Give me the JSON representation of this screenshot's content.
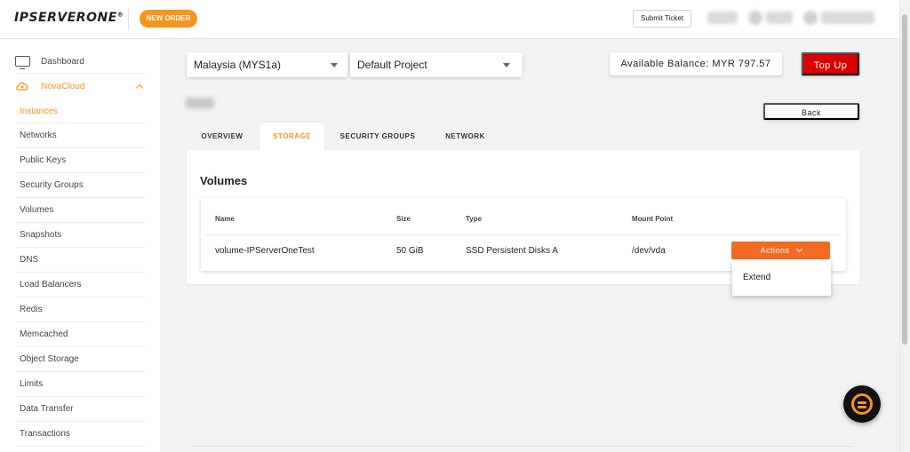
{
  "header": {
    "logo_text": "IPSERVERONE",
    "logo_reg": "®",
    "new_order_label": "NEW ORDER",
    "submit_ticket_label": "Submit Ticket"
  },
  "sidebar": {
    "items": [
      {
        "label": "Dashboard"
      },
      {
        "label": "NovaCloud"
      },
      {
        "label": "Instances"
      },
      {
        "label": "Networks"
      },
      {
        "label": "Public Keys"
      },
      {
        "label": "Security Groups"
      },
      {
        "label": "Volumes"
      },
      {
        "label": "Snapshots"
      },
      {
        "label": "DNS"
      },
      {
        "label": "Load Balancers"
      },
      {
        "label": "Redis"
      },
      {
        "label": "Memcached"
      },
      {
        "label": "Object Storage"
      },
      {
        "label": "Limits"
      },
      {
        "label": "Data Transfer"
      },
      {
        "label": "Transactions"
      }
    ],
    "active_item": "Instances"
  },
  "toolbar": {
    "region_value": "Malaysia (MYS1a)",
    "project_value": "Default Project",
    "balance_text": "Available Balance: MYR 797.57",
    "topup_label": "Top Up",
    "back_label": "Back"
  },
  "tabs": [
    {
      "label": "OVERVIEW"
    },
    {
      "label": "STORAGE"
    },
    {
      "label": "SECURITY GROUPS"
    },
    {
      "label": "NETWORK"
    }
  ],
  "active_tab": "STORAGE",
  "volumes": {
    "title": "Volumes",
    "columns": [
      "Name",
      "Size",
      "Type",
      "Mount Point"
    ],
    "rows": [
      {
        "name": "volume-IPServerOneTest",
        "size": "50 GiB",
        "type": "SSD Persistent Disks A",
        "mount_point": "/dev/vda"
      }
    ],
    "actions_label": "Actions",
    "dropdown_items": [
      "Extend"
    ]
  },
  "colors": {
    "accent": "#f7941d",
    "actions": "#f26b21",
    "topup": "#d80000"
  }
}
